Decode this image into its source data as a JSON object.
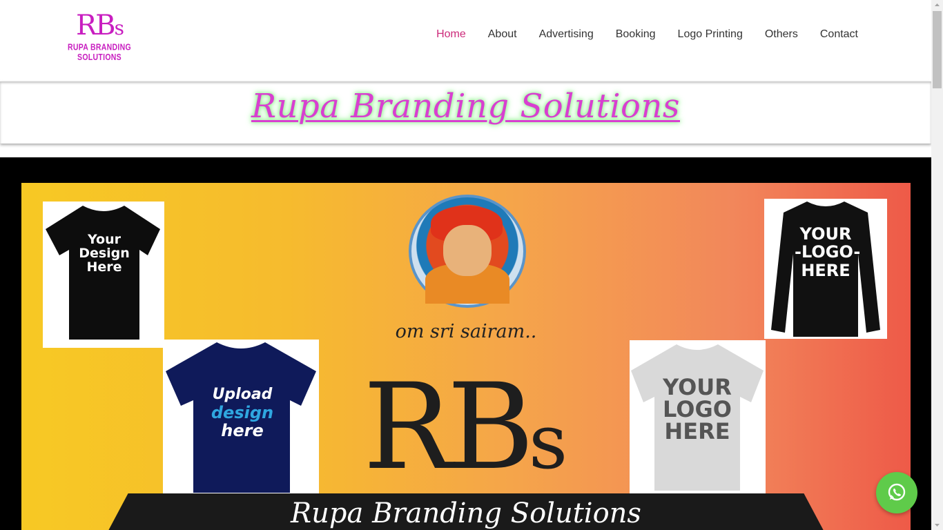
{
  "header": {
    "logo_mark": "RB",
    "logo_mark_small": "s",
    "logo_subtitle": "RUPA BRANDING SOLUTIONS",
    "nav": [
      {
        "label": "Home",
        "active": true
      },
      {
        "label": "About"
      },
      {
        "label": "Advertising"
      },
      {
        "label": "Booking"
      },
      {
        "label": "Logo Printing"
      },
      {
        "label": "Others"
      },
      {
        "label": "Contact"
      }
    ]
  },
  "hero": {
    "title": "Rupa Branding Solutions"
  },
  "banner": {
    "tee_1": "Your\nDesign\nHere",
    "tee_2_a": "Upload",
    "tee_2_b": "design",
    "tee_2_c": "here",
    "tee_3": "YOUR\n-LOGO-\nHERE",
    "tee_4": "YOUR\nLOGO\nHERE",
    "caption": "om sri sairam..",
    "big_mark": "RB",
    "big_mark_small": "s",
    "bar_text": "Rupa Branding Solutions"
  },
  "colors": {
    "brand": "#c81ec0",
    "nav_active": "#cc2a7a",
    "whatsapp": "#5fcb4a"
  },
  "floating": {
    "icon": "whatsapp-icon"
  }
}
